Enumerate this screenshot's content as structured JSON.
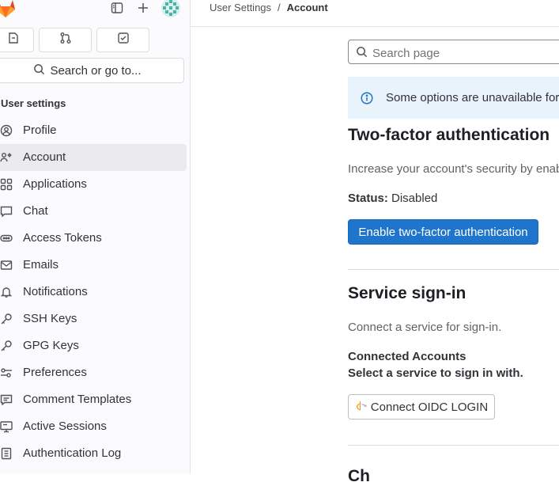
{
  "sidebar": {
    "search_label": "Search or go to...",
    "section_title": "User settings",
    "items": [
      {
        "label": "Profile",
        "icon": "profile-icon",
        "active": false
      },
      {
        "label": "Account",
        "icon": "account-icon",
        "active": true
      },
      {
        "label": "Applications",
        "icon": "applications-icon",
        "active": false
      },
      {
        "label": "Chat",
        "icon": "chat-icon",
        "active": false
      },
      {
        "label": "Access Tokens",
        "icon": "token-icon",
        "active": false
      },
      {
        "label": "Emails",
        "icon": "mail-icon",
        "active": false
      },
      {
        "label": "Notifications",
        "icon": "bell-icon",
        "active": false
      },
      {
        "label": "SSH Keys",
        "icon": "key-icon",
        "active": false
      },
      {
        "label": "GPG Keys",
        "icon": "key-icon",
        "active": false
      },
      {
        "label": "Preferences",
        "icon": "preferences-icon",
        "active": false
      },
      {
        "label": "Comment Templates",
        "icon": "comment-icon",
        "active": false
      },
      {
        "label": "Active Sessions",
        "icon": "monitor-icon",
        "active": false
      },
      {
        "label": "Authentication Log",
        "icon": "log-icon",
        "active": false
      }
    ]
  },
  "breadcrumb": {
    "parent": "User Settings",
    "separator": "/",
    "current": "Account"
  },
  "main": {
    "search_placeholder": "Search page",
    "alert_text": "Some options are unavailable for",
    "two_factor": {
      "title": "Two-factor authentication",
      "description": "Increase your account's security by enabl",
      "status_label": "Status:",
      "status_value": "Disabled",
      "button_label": "Enable two-factor authentication"
    },
    "service_signin": {
      "title": "Service sign-in",
      "description": "Connect a service for sign-in.",
      "connected_heading": "Connected Accounts",
      "select_heading": "Select a service to sign in with.",
      "oidc_button_label": "Connect OIDC LOGIN"
    },
    "next_section_title": "Ch"
  },
  "colors": {
    "primary": "#1f75cb",
    "alert_bg": "#e9f3fc",
    "sidebar_bg": "#fbfafd",
    "active_item_bg": "#ebebee"
  }
}
